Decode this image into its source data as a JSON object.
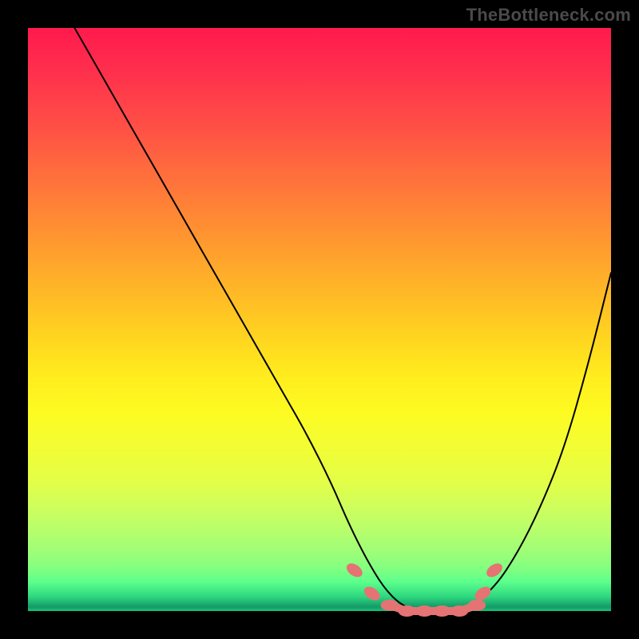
{
  "branding": {
    "text": "TheBottleneck.com"
  },
  "palette": {
    "black": "#000000",
    "marker": "#e57373",
    "gradient_top": "#ff1a4d",
    "gradient_mid": "#ffed1e",
    "gradient_bottom": "#19c379"
  },
  "chart_data": {
    "type": "line",
    "title": "",
    "xlabel": "",
    "ylabel": "",
    "xlim": [
      0,
      100
    ],
    "ylim": [
      0,
      100
    ],
    "grid": false,
    "legend": false,
    "annotations": [],
    "series": [
      {
        "name": "bottleneck-curve",
        "x": [
          8,
          12,
          16,
          20,
          24,
          28,
          32,
          36,
          40,
          44,
          48,
          52,
          55,
          58,
          61,
          64,
          67,
          70,
          73,
          76,
          80,
          84,
          88,
          92,
          96,
          100
        ],
        "y": [
          100,
          93,
          86,
          79,
          72,
          65,
          58,
          51,
          44,
          37,
          30,
          22,
          15,
          9,
          4,
          1,
          0,
          0,
          0,
          1,
          4,
          10,
          18,
          28,
          42,
          58
        ]
      }
    ],
    "highlighted_points": {
      "name": "flat-bottom-markers",
      "x": [
        56,
        59,
        62,
        65,
        68,
        71,
        74,
        77,
        78,
        80
      ],
      "y": [
        7,
        3,
        1,
        0,
        0,
        0,
        0,
        1,
        3,
        7
      ]
    }
  }
}
